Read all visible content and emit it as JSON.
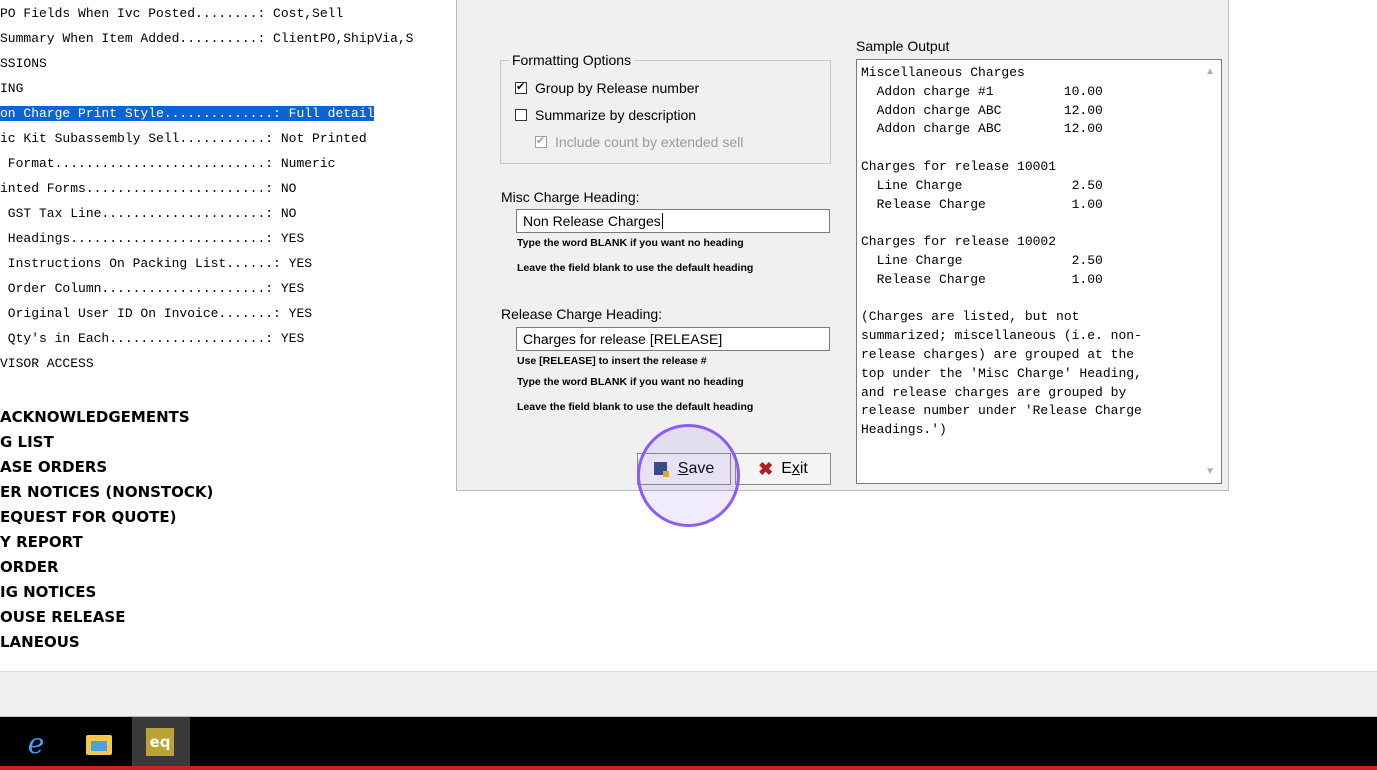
{
  "background_list": {
    "mono_rows": [
      "PO Fields When Ivc Posted........: Cost,Sell",
      "Summary When Item Added..........: ClientPO,ShipVia,S",
      "SSIONS",
      "ING",
      "on Charge Print Style..............: Full detail",
      "ic Kit Subassembly Sell...........: Not Printed",
      " Format...........................: Numeric",
      "inted Forms.......................: NO",
      " GST Tax Line.....................: NO",
      " Headings.........................: YES",
      " Instructions On Packing List......: YES",
      " Order Column.....................: YES",
      " Original User ID On Invoice.......: YES",
      " Qty's in Each....................: YES",
      "VISOR ACCESS",
      ""
    ],
    "selected_index": 4,
    "bold_rows": [
      "ACKNOWLEDGEMENTS",
      "G LIST",
      "ASE ORDERS",
      "ER NOTICES (NONSTOCK)",
      "EQUEST FOR QUOTE)",
      "Y REPORT",
      "ORDER",
      "IG NOTICES",
      "OUSE RELEASE",
      "LANEOUS"
    ]
  },
  "dialog": {
    "formatting_title": "Formatting Options",
    "opt_group": {
      "label": "Group by Release number",
      "checked": true
    },
    "opt_summarize": {
      "label": "Summarize by description",
      "checked": false
    },
    "opt_count": {
      "label": "Include count by extended sell",
      "checked": true,
      "disabled": true
    },
    "misc_label": "Misc Charge Heading:",
    "misc_value": "Non Release Charges",
    "misc_hint1": "Type the word BLANK if you want no heading",
    "misc_hint2": "Leave the field blank to use the default heading",
    "release_label": "Release Charge Heading:",
    "release_value": "Charges for release [RELEASE]",
    "release_hint1": "Use [RELEASE] to insert the release #",
    "release_hint2": "Type the word BLANK if you want no heading",
    "release_hint3": "Leave the field blank to use the default heading",
    "save_label_u": "S",
    "save_label_rest": "ave",
    "exit_label_pre": "E",
    "exit_label_u": "x",
    "exit_label_rest": "it",
    "sample_label": "Sample Output",
    "sample_text": "Miscellaneous Charges\n  Addon charge #1         10.00\n  Addon charge ABC        12.00\n  Addon charge ABC        12.00\n\nCharges for release 10001\n  Line Charge              2.50\n  Release Charge           1.00\n\nCharges for release 10002\n  Line Charge              2.50\n  Release Charge           1.00\n\n(Charges are listed, but not\nsummarized; miscellaneous (i.e. non-\nrelease charges) are grouped at the\ntop under the 'Misc Charge' Heading,\nand release charges are grouped by\nrelease number under 'Release Charge\nHeadings.')"
  },
  "taskbar": {
    "ie_icon": "internet-explorer-icon",
    "folder_icon": "file-explorer-icon",
    "eq_icon_text": "eq",
    "accent_color": "#d11f1f"
  },
  "colors": {
    "selection": "#0a64d6",
    "highlight_ring": "#8b5cf6"
  }
}
